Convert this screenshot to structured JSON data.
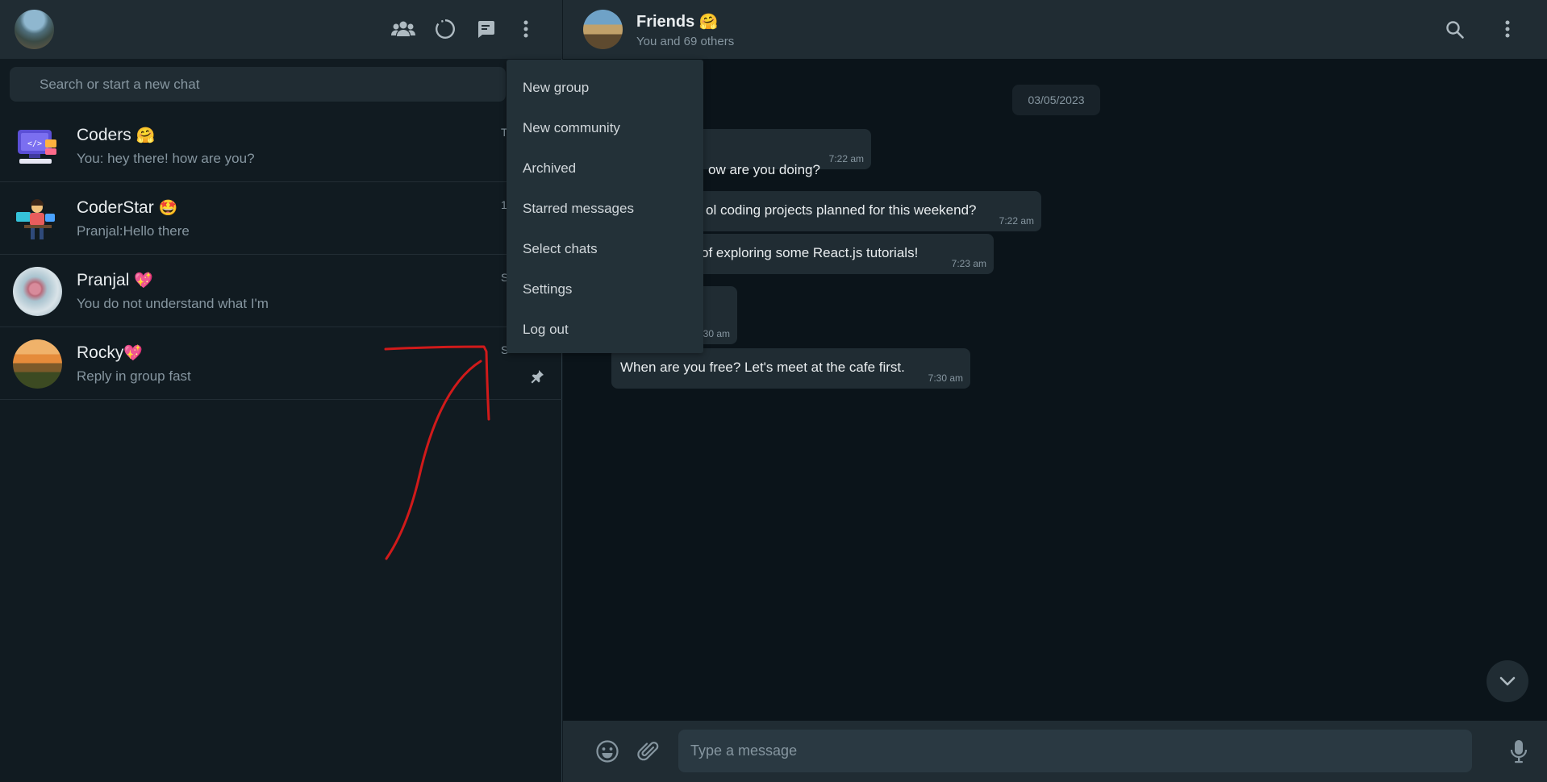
{
  "left_header": {
    "icons": [
      "communities-icon",
      "status-icon",
      "new-chat-icon",
      "menu-icon"
    ]
  },
  "search": {
    "placeholder": "Search or start a new chat"
  },
  "chats": [
    {
      "name": "Coders",
      "emoji": "🤗",
      "preview": "You: hey there! how are you?",
      "time": "T"
    },
    {
      "name": "CoderStar",
      "emoji": "🤩",
      "preview": "Pranjal:Hello there",
      "time": "1("
    },
    {
      "name": "Pranjal",
      "emoji": "💖",
      "preview": "You do not understand what I'm",
      "time": "S"
    },
    {
      "name": "Rocky",
      "emoji": "💖",
      "preview": "Reply in group fast",
      "time": "S",
      "pinned": true
    }
  ],
  "menu": {
    "items": [
      "New group",
      "New community",
      "Archived",
      "Starred messages",
      "Select chats",
      "Settings",
      "Log out"
    ]
  },
  "conversation": {
    "name": "Friends",
    "emoji": "🤗",
    "subtitle": "You and 69 others",
    "date": "03/05/2023",
    "messages": [
      {
        "text": "ow are you doing?",
        "time": "7:22 am"
      },
      {
        "text": "ol coding projects planned for this weekend?",
        "time": "7:22 am"
      },
      {
        "text": "of exploring some React.js tutorials!",
        "time": "7:23 am"
      },
      {
        "text": "",
        "time": "30 am"
      },
      {
        "text": "When are you free? Let's meet at the cafe first.",
        "time": "7:30 am"
      }
    ]
  },
  "composer": {
    "placeholder": "Type a message"
  },
  "colors": {
    "panel": "#202c33",
    "background": "#111b21",
    "chat_background": "#0b141a",
    "menu": "#233138",
    "annotation_stroke": "#d11a1a"
  }
}
